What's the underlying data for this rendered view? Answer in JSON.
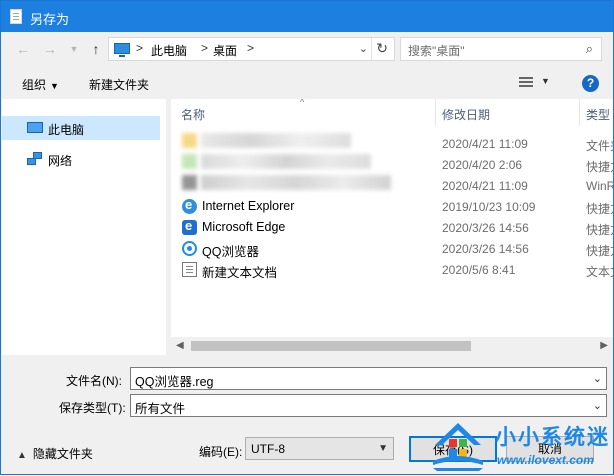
{
  "window": {
    "title": "另存为"
  },
  "nav": {
    "back_icon": "back-arrow-icon",
    "forward_icon": "forward-arrow-icon",
    "recent_icon": "chevron-down-icon",
    "up_icon": "up-arrow-icon"
  },
  "address": {
    "crumbs": [
      "此电脑",
      "桌面"
    ],
    "separator": ">"
  },
  "search": {
    "placeholder": "搜索\"桌面\""
  },
  "toolbar": {
    "organize_label": "组织",
    "new_folder_label": "新建文件夹",
    "help_label": "?"
  },
  "sidebar": {
    "items": [
      {
        "label": "此电脑",
        "icon": "computer-icon",
        "selected": true
      },
      {
        "label": "网络",
        "icon": "network-icon",
        "selected": false
      }
    ]
  },
  "columns": {
    "name": "名称",
    "date": "修改日期",
    "type": "类型"
  },
  "files": [
    {
      "name": "",
      "date": "2020/4/21 11:09",
      "type": "文件夹",
      "blurred": true
    },
    {
      "name": "",
      "date": "2020/4/20 2:06",
      "type": "快捷方式",
      "blurred": true
    },
    {
      "name": "",
      "date": "2020/4/21 11:09",
      "type": "WinRAR",
      "blurred": true
    },
    {
      "name": "Internet Explorer",
      "date": "2019/10/23 10:09",
      "type": "快捷方式",
      "icon": "ie-icon"
    },
    {
      "name": "Microsoft Edge",
      "date": "2020/3/26 14:56",
      "type": "快捷方式",
      "icon": "edge-icon"
    },
    {
      "name": "QQ浏览器",
      "date": "2020/3/26 14:56",
      "type": "快捷方式",
      "icon": "qq-browser-icon"
    },
    {
      "name": "新建文本文档",
      "date": "2020/5/6 8:41",
      "type": "文本文档",
      "icon": "text-file-icon"
    }
  ],
  "filename": {
    "label": "文件名(N):",
    "value": "QQ浏览器.reg"
  },
  "filetype": {
    "label": "保存类型(T):",
    "value": "所有文件"
  },
  "footer": {
    "hide_folders_label": "隐藏文件夹",
    "encoding_label": "编码(E):",
    "encoding_value": "UTF-8",
    "save_label": "保存(S)",
    "cancel_label": "取消"
  },
  "watermark": {
    "title": "小小系统迷",
    "url": "www.ilovext.com"
  }
}
